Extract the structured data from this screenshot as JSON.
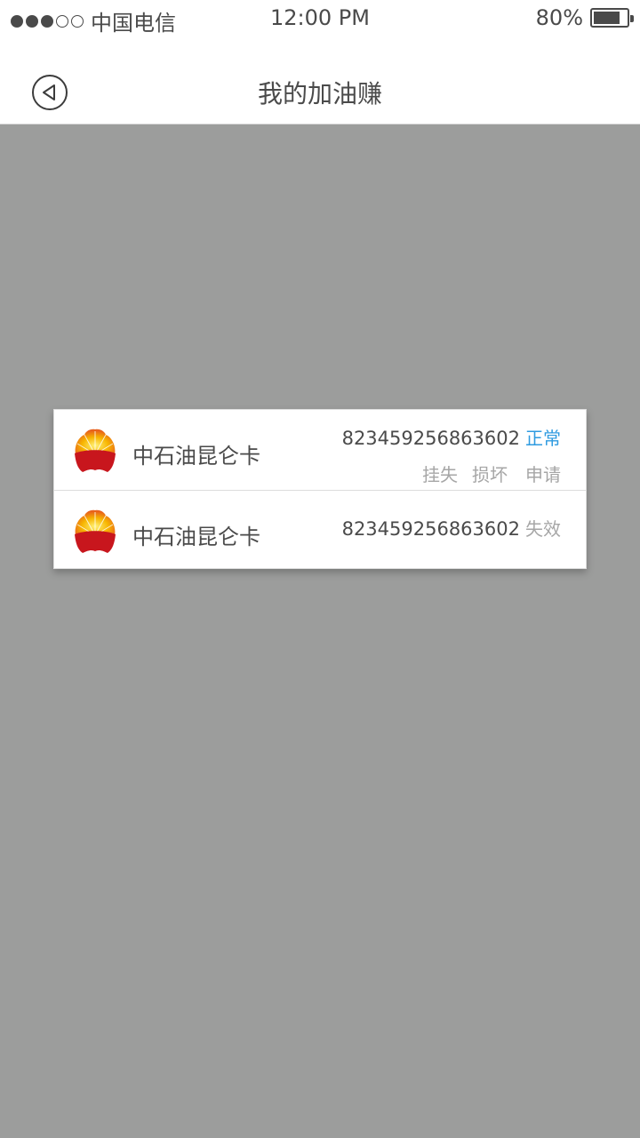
{
  "status_bar": {
    "carrier": "中国电信",
    "time": "12:00 PM",
    "battery": "80%",
    "battery_level": 0.8,
    "signal_bars_filled": 3,
    "signal_bars_total": 5
  },
  "nav": {
    "title": "我的加油赚",
    "back_icon": "back-circle-icon"
  },
  "cards": [
    {
      "name": "中石油昆仑卡",
      "number": "823459256863602",
      "status": "正常",
      "status_color": "#2f9be0",
      "actions": {
        "report_lost": "挂失",
        "damaged": "损坏",
        "apply": "申请"
      }
    },
    {
      "name": "中石油昆仑卡",
      "number": "823459256863602",
      "status": "失效",
      "status_color": "#a6a6a6"
    }
  ],
  "colors": {
    "overlay_background": "#9c9d9c",
    "logo_red": "#c8161d",
    "logo_yellow": "#f5b700"
  }
}
